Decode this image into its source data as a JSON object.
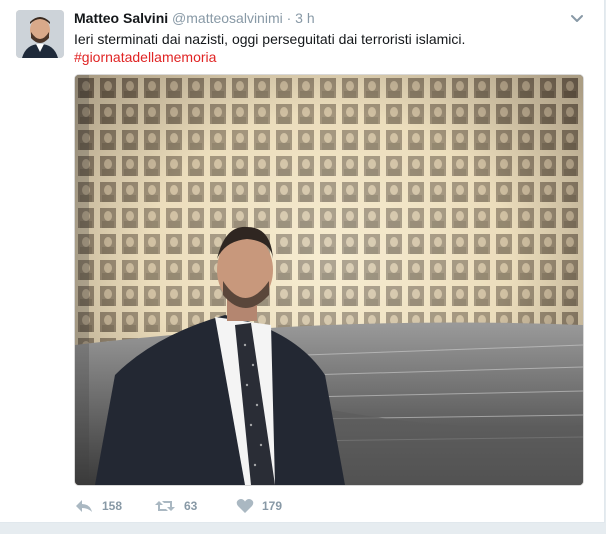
{
  "tweet": {
    "author_name": "Matteo Salvini",
    "author_handle": "@matteosalvinimi",
    "separator": "·",
    "time": "3 h",
    "text": "Ieri sterminati dai nazisti, oggi perseguitati dai terroristi islamici.",
    "hashtag": "#giornatadellamemoria",
    "hashtag_color": "#e02424"
  },
  "actions": {
    "reply_count": "158",
    "retweet_count": "63",
    "like_count": "179"
  },
  "icons": [
    "avatar-image",
    "chevron-down-icon",
    "reply-icon",
    "retweet-icon",
    "heart-icon"
  ]
}
